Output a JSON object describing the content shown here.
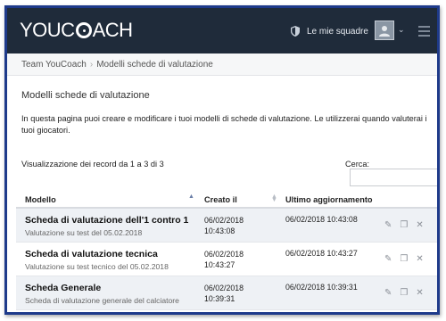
{
  "navbar": {
    "logo_text_a": "YOUC",
    "logo_text_b": "ACH",
    "team_link": "Le mie squadre",
    "caret": "⌄"
  },
  "breadcrumb": {
    "items": [
      "Team YouCoach",
      "Modelli schede di valutazione"
    ],
    "separator": "›"
  },
  "page": {
    "title": "Modelli schede di valutazione",
    "intro": "In questa pagina puoi creare e modificare i tuoi modelli di schede di valutazione. Le utilizzerai quando valuterai i tuoi giocatori.",
    "records_info": "Visualizzazione dei record da 1 a 3 di 3",
    "search_label": "Cerca:",
    "search_value": ""
  },
  "table": {
    "headers": [
      "Modello",
      "Creato il",
      "Ultimo aggiornamento"
    ],
    "rows": [
      {
        "name": "Scheda di valutazione dell'1 contro 1",
        "desc": "Valutazione su test del 05.02.2018",
        "created_date": "06/02/2018",
        "created_time": "10:43:08",
        "updated": "06/02/2018 10:43:08"
      },
      {
        "name": "Scheda di valutazione tecnica",
        "desc": "Valutazione su test tecnico del 05.02.2018",
        "created_date": "06/02/2018",
        "created_time": "10:43:27",
        "updated": "06/02/2018 10:43:27"
      },
      {
        "name": "Scheda Generale",
        "desc": "Scheda di valutazione generale del calciatore",
        "created_date": "06/02/2018",
        "created_time": "10:39:31",
        "updated": "06/02/2018 10:39:31"
      }
    ]
  },
  "icons": {
    "edit": "pencil-icon",
    "duplicate": "copy-icon",
    "delete": "close-icon",
    "team": "shield-icon",
    "menu": "hamburger-icon"
  },
  "colors": {
    "navbar": "#1f2b3a",
    "frame_border": "#1e3a8a",
    "row_shaded": "#eef1f5"
  }
}
